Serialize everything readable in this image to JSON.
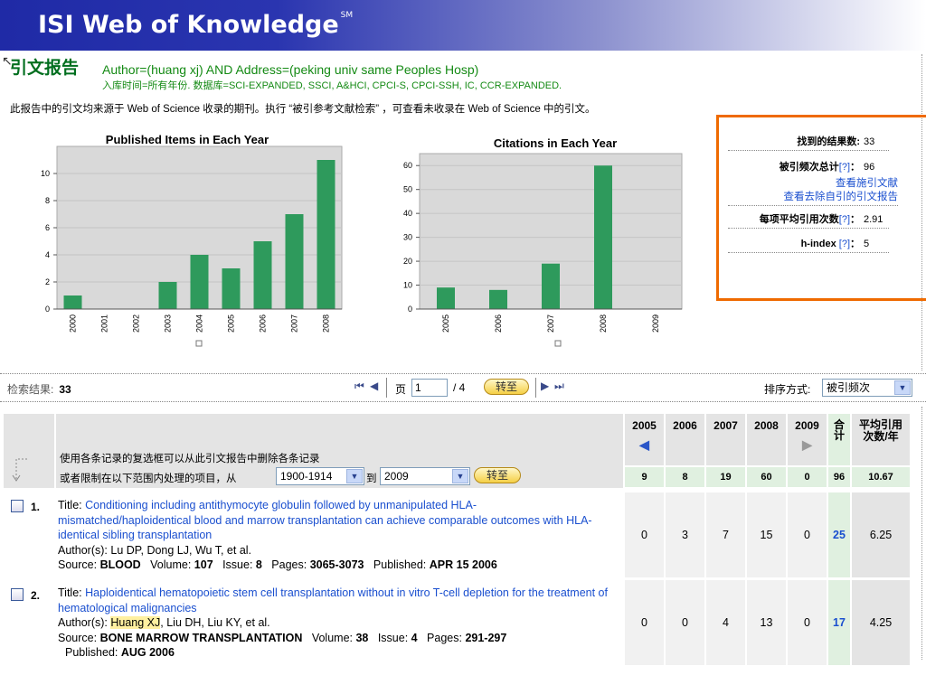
{
  "header": {
    "title": "ISI Web of Knowledge",
    "trademark": "SM"
  },
  "report": {
    "title": "引文报告",
    "query": "Author=(huang xj) AND Address=(peking univ same Peoples Hosp)",
    "subtitle": "入库时间=所有年份. 数据库=SCI-EXPANDED, SSCI, A&HCI, CPCI-S, CPCI-SSH, IC, CCR-EXPANDED.",
    "note": "此报告中的引文均来源于 Web of Science 收录的期刊。执行 “被引参考文献检索” ，可查看未收录在 Web of Science 中的引文。"
  },
  "chart_data": [
    {
      "type": "bar",
      "title": "Published Items in Each Year",
      "categories": [
        "2000",
        "2001",
        "2002",
        "2003",
        "2004",
        "2005",
        "2006",
        "2007",
        "2008"
      ],
      "values": [
        1,
        0,
        0,
        2,
        4,
        3,
        5,
        7,
        11
      ],
      "ylim": [
        0,
        12
      ],
      "yticks": [
        0,
        2,
        4,
        6,
        8,
        10
      ],
      "bar_color": "#2e9a5c",
      "grid": true
    },
    {
      "type": "bar",
      "title": "Citations in Each Year",
      "categories": [
        "2005",
        "2006",
        "2007",
        "2008",
        "2009"
      ],
      "values": [
        9,
        8,
        19,
        60,
        0
      ],
      "ylim": [
        0,
        65
      ],
      "yticks": [
        0,
        10,
        20,
        30,
        40,
        50,
        60
      ],
      "bar_color": "#2e9a5c",
      "grid": true
    }
  ],
  "stats": {
    "results_label": "找到的结果数:",
    "results_value": "33",
    "times_cited_label": "被引频次总计",
    "times_cited_value": "96",
    "help_label": "[?]",
    "view_citing_link": "查看施引文献",
    "view_no_self_link": "查看去除自引的引文报告",
    "avg_label": "每项平均引用次数",
    "avg_value": "2.91",
    "hindex_label": "h-index",
    "hindex_value": "5",
    "colon": "："
  },
  "results_bar": {
    "label": "检索结果:",
    "count": "33",
    "page_label": "页",
    "page_value": "1",
    "page_total": "/ 4",
    "go_button": "转至",
    "sort_label": "排序方式:",
    "sort_value": "被引频次"
  },
  "table": {
    "filter_note": "使用各条记录的复选框可以从此引文报告中删除各条记录",
    "filter_range_prefix": "或者限制在以下范围内处理的项目，从",
    "filter_from": "1900-1914",
    "filter_to_label": "到",
    "filter_to": "2009",
    "filter_button": "转至",
    "years": [
      "2005",
      "2006",
      "2007",
      "2008",
      "2009"
    ],
    "total_header": "合计",
    "avg_header": "平均引用次数/年",
    "year_totals": [
      "9",
      "8",
      "19",
      "60",
      "0"
    ],
    "grand_total": "96",
    "grand_avg": "10.67",
    "records": [
      {
        "num": "1.",
        "title_label": "Title:",
        "title": "Conditioning including antithymocyte globulin followed by unmanipulated HLA-mismatched/haploidentical blood and marrow transplantation can achieve comparable outcomes with HLA-identical sibling transplantation",
        "authors_label": "Author(s):",
        "authors": "Lu DP, Dong LJ, Wu T, et al.",
        "source_label": "Source:",
        "source": "BLOOD",
        "volume_label": "Volume:",
        "volume": "107",
        "issue_label": "Issue:",
        "issue": "8",
        "pages_label": "Pages:",
        "pages": "3065-3073",
        "published_label": "Published:",
        "published": "APR 15 2006",
        "counts": [
          "0",
          "3",
          "7",
          "15",
          "0"
        ],
        "total": "25",
        "avg": "6.25"
      },
      {
        "num": "2.",
        "title_label": "Title:",
        "title": "Haploidentical hematopoietic stem cell transplantation without in vitro T-cell depletion for the treatment of hematological malignancies",
        "authors_label": "Author(s):",
        "authors_highlight": "Huang XJ",
        "authors_rest": ", Liu DH, Liu KY, et al.",
        "source_label": "Source:",
        "source": "BONE MARROW TRANSPLANTATION",
        "volume_label": "Volume:",
        "volume": "38",
        "issue_label": "Issue:",
        "issue": "4",
        "pages_label": "Pages:",
        "pages": "291-297",
        "published_label": "Published:",
        "published": "AUG 2006",
        "counts": [
          "0",
          "0",
          "4",
          "13",
          "0"
        ],
        "total": "17",
        "avg": "4.25"
      }
    ]
  }
}
